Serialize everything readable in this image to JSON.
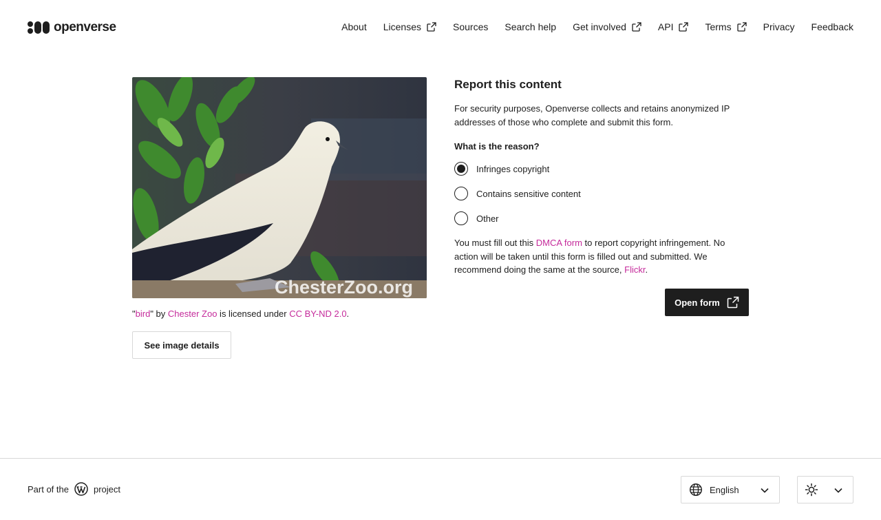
{
  "header": {
    "logo_text": "openverse",
    "nav": [
      {
        "label": "About",
        "external": false
      },
      {
        "label": "Licenses",
        "external": true
      },
      {
        "label": "Sources",
        "external": false
      },
      {
        "label": "Search help",
        "external": false
      },
      {
        "label": "Get involved",
        "external": true
      },
      {
        "label": "API",
        "external": true
      },
      {
        "label": "Terms",
        "external": true
      },
      {
        "label": "Privacy",
        "external": false
      },
      {
        "label": "Feedback",
        "external": false
      }
    ]
  },
  "image": {
    "watermark": "ChesterZoo.org",
    "attribution": {
      "quote_open": "\"",
      "title": "bird",
      "by": "\" by ",
      "creator": "Chester Zoo",
      "licensed": " is licensed under ",
      "license": "CC BY-ND 2.0",
      "end": "."
    },
    "details_button": "See image details"
  },
  "report": {
    "title": "Report this content",
    "intro": "For security purposes, Openverse collects and retains anonymized IP addresses of those who complete and submit this form.",
    "question": "What is the reason?",
    "options": [
      {
        "label": "Infringes copyright",
        "selected": true
      },
      {
        "label": "Contains sensitive content",
        "selected": false
      },
      {
        "label": "Other",
        "selected": false
      }
    ],
    "note": {
      "part1": "You must fill out this ",
      "link1": "DMCA form",
      "part2": " to report copyright infringement. No action will be taken until this form is filled out and submitted. We recommend doing the same at the source, ",
      "link2": "Flickr",
      "part3": "."
    },
    "open_button": "Open form"
  },
  "footer": {
    "part_of": "Part of the",
    "project": "project",
    "language": "English"
  },
  "colors": {
    "accent_link": "#c52b9b",
    "dark": "#1e1e1e",
    "border": "#d8d8d8"
  }
}
